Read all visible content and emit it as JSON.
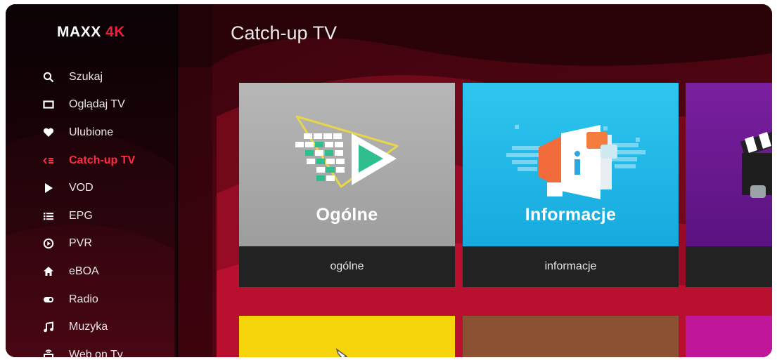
{
  "logo": {
    "part1": "MAXX",
    "part2": "4K"
  },
  "sidebar": {
    "items": [
      {
        "label": "Szukaj",
        "icon": "search-icon",
        "active": false
      },
      {
        "label": "Oglądaj TV",
        "icon": "tv-icon",
        "active": false
      },
      {
        "label": "Ulubione",
        "icon": "heart-icon",
        "active": false
      },
      {
        "label": "Catch-up TV",
        "icon": "catchup-icon",
        "active": true
      },
      {
        "label": "VOD",
        "icon": "play-icon",
        "active": false
      },
      {
        "label": "EPG",
        "icon": "list-icon",
        "active": false
      },
      {
        "label": "PVR",
        "icon": "record-icon",
        "active": false
      },
      {
        "label": "eBOA",
        "icon": "home-icon",
        "active": false
      },
      {
        "label": "Radio",
        "icon": "radio-icon",
        "active": false
      },
      {
        "label": "Muzyka",
        "icon": "music-note-icon",
        "active": false
      },
      {
        "label": "Web on Tv",
        "icon": "web-tv-icon",
        "active": false
      }
    ]
  },
  "main": {
    "title": "Catch-up TV",
    "cards": [
      {
        "caption": "ogólne",
        "thumb_title": "Ogólne",
        "bg": "#a9a9a9"
      },
      {
        "caption": "informacje",
        "thumb_title": "Informacje",
        "bg": "#1fb9e6"
      },
      {
        "caption": "",
        "thumb_title": "",
        "bg": "#6a1a8c"
      }
    ],
    "row2_colors": [
      "#f6d40b",
      "#8a5232",
      "#c0179a"
    ]
  },
  "colors": {
    "accent": "#ff2b45",
    "caption_bg": "#222222"
  }
}
